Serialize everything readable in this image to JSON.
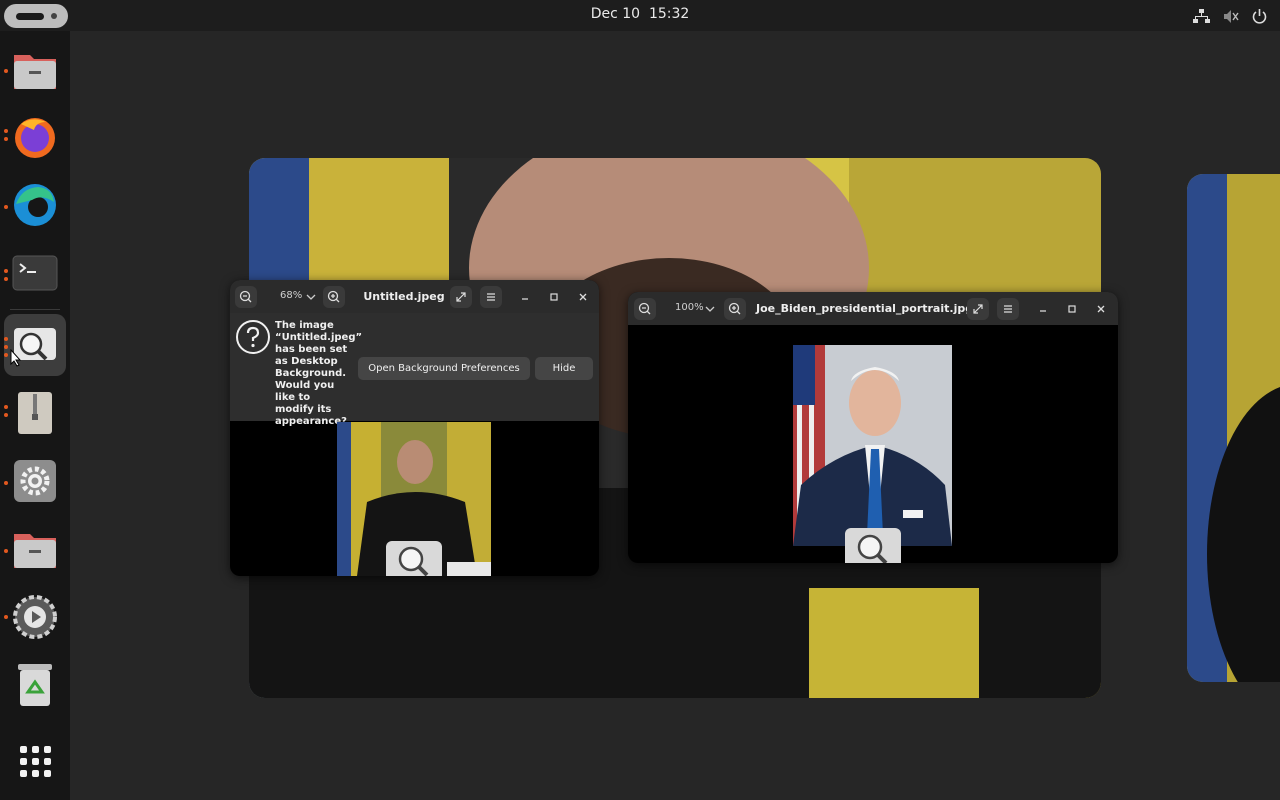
{
  "topbar": {
    "date": "Dec 10",
    "time": "15:32",
    "tray": [
      "network-icon",
      "volume-muted-icon",
      "power-icon"
    ]
  },
  "dock": {
    "apps": [
      "files",
      "firefox",
      "edge",
      "terminal",
      "image-viewer",
      "archive-manager",
      "settings",
      "files",
      "system-settings",
      "trash",
      "show-apps"
    ],
    "running": [
      "files",
      "firefox",
      "edge",
      "terminal",
      "image-viewer",
      "archive-manager",
      "settings",
      "files",
      "system-settings"
    ],
    "active": "image-viewer"
  },
  "window1": {
    "title": "Untitled.jpeg",
    "zoom": "68%",
    "notice_text": "The image “Untitled.jpeg” has been set as Desktop Background. Would you like to modify its appearance?",
    "notice_open_button": "Open Background Preferences",
    "notice_hide_button": "Hide"
  },
  "window2": {
    "title": "Joe_Biden_presidential_portrait.jpg",
    "zoom": "100%"
  },
  "colors": {
    "accent": "#e2581f",
    "panel": "#1d1d1d",
    "dock": "#161616",
    "header": "#2b2b2b"
  }
}
